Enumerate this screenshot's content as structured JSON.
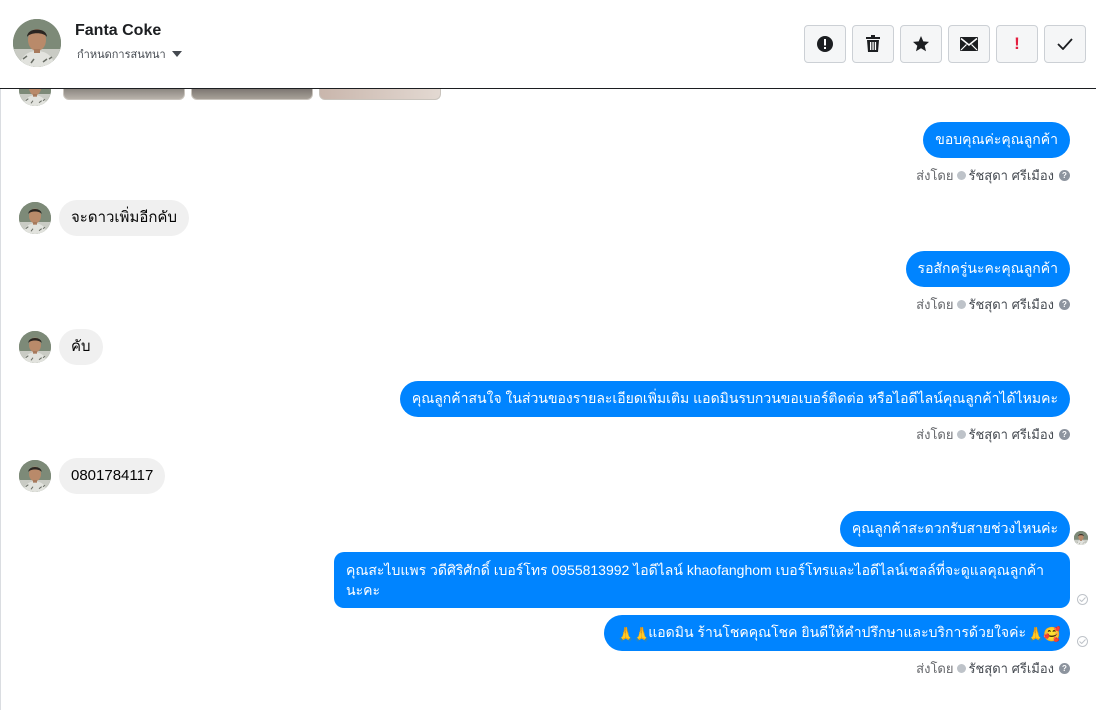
{
  "header": {
    "contact_name": "Fanta Coke",
    "conversation_settings": "กำหนดการสนทนา"
  },
  "toolbar": [
    {
      "icon": "alert-circle-icon",
      "label": ""
    },
    {
      "icon": "trash-icon",
      "label": ""
    },
    {
      "icon": "star-icon",
      "label": ""
    },
    {
      "icon": "envelope-icon",
      "label": ""
    },
    {
      "icon": "exclamation-icon",
      "label": "!"
    },
    {
      "icon": "checkmark-icon",
      "label": ""
    }
  ],
  "messages": [
    {
      "from": "page",
      "text": "ขอบคุณค่ะคุณลูกค้า",
      "sent_by_prefix": "ส่งโดย",
      "sender": "รัชสุดา ศรีเมือง"
    },
    {
      "from": "customer",
      "text": "จะดาวเพิ่มอีกคับ"
    },
    {
      "from": "page",
      "text": "รอสักครู่นะคะคุณลูกค้า",
      "sent_by_prefix": "ส่งโดย",
      "sender": "รัชสุดา ศรีเมือง"
    },
    {
      "from": "customer",
      "text": "คับ"
    },
    {
      "from": "page",
      "text": "คุณลูกค้าสนใจ ในส่วนของรายละเอียดเพิ่มเติม แอดมินรบกวนขอเบอร์ติดต่อ หรือไอดีไลน์คุณลูกค้าได้ไหมคะ",
      "sent_by_prefix": "ส่งโดย",
      "sender": "รัชสุดา ศรีเมือง"
    },
    {
      "from": "customer",
      "text": "0801784117"
    },
    {
      "from": "page",
      "text": "คุณลูกค้าสะดวกรับสายช่วงไหนค่ะ"
    },
    {
      "from": "page",
      "text": "คุณสะไบแพร วดีศิริศักดิ์ เบอร์โทร 0955813992  ไอดีไลน์  khaofanghom   เบอร์โทรและไอดีไลน์เซลล์ที่จะดูแลคุณลูกค้านะคะ"
    },
    {
      "from": "page",
      "text": "แอดมิน ร้านโชคคุณโชค ยินดีให้คำปรึกษาและบริการด้วยใจค่ะ",
      "sent_by_prefix": "ส่งโดย",
      "sender": "รัชสุดา ศรีเมือง"
    }
  ],
  "emoji": {
    "pray": "🙏",
    "love_face": "🥰"
  },
  "colors": {
    "outgoing_bubble": "#0084ff",
    "incoming_bubble": "#f0f0f0",
    "toolbar_alert": "#e41e3f"
  }
}
